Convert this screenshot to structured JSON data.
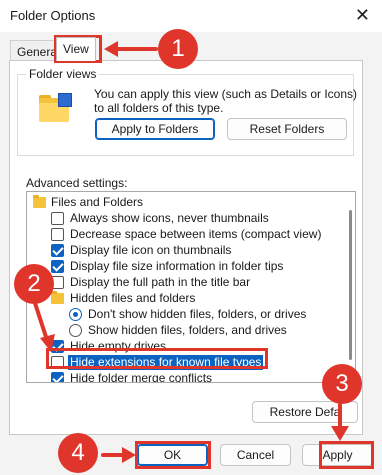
{
  "window": {
    "title": "Folder Options",
    "close_glyph": "✕"
  },
  "tabs": [
    {
      "label": "General"
    },
    {
      "label": "View"
    }
  ],
  "folder_views": {
    "label": "Folder views",
    "description": "You can apply this view (such as Details or Icons) to all folders of this type.",
    "apply_label": "Apply to Folders",
    "reset_label": "Reset Folders"
  },
  "advanced": {
    "label": "Advanced settings:",
    "items": [
      {
        "kind": "folder",
        "label": "Files and Folders"
      },
      {
        "kind": "checkbox",
        "checked": false,
        "label": "Always show icons, never thumbnails"
      },
      {
        "kind": "checkbox",
        "checked": false,
        "label": "Decrease space between items (compact view)"
      },
      {
        "kind": "checkbox",
        "checked": true,
        "label": "Display file icon on thumbnails"
      },
      {
        "kind": "checkbox",
        "checked": true,
        "label": "Display file size information in folder tips"
      },
      {
        "kind": "checkbox",
        "checked": false,
        "label": "Display the full path in the title bar"
      },
      {
        "kind": "folder",
        "label": "Hidden files and folders"
      },
      {
        "kind": "radio",
        "checked": true,
        "label": "Don't show hidden files, folders, or drives"
      },
      {
        "kind": "radio",
        "checked": false,
        "label": "Show hidden files, folders, and drives"
      },
      {
        "kind": "checkbox",
        "checked": true,
        "label": "Hide empty drives"
      },
      {
        "kind": "checkbox",
        "checked": false,
        "label": "Hide extensions for known file types",
        "highlighted": true
      },
      {
        "kind": "checkbox",
        "checked": true,
        "label": "Hide folder merge conflicts"
      }
    ]
  },
  "buttons": {
    "restore": "Restore Defa",
    "ok": "OK",
    "cancel": "Cancel",
    "apply": "Apply"
  },
  "annotations": {
    "step1": "1",
    "step2": "2",
    "step3": "3",
    "step4": "4",
    "color": "#e0352b"
  }
}
